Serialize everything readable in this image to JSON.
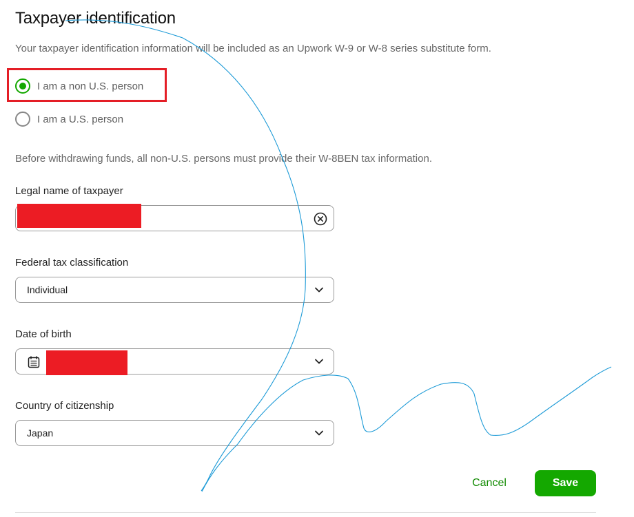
{
  "page": {
    "title": "Taxpayer identification",
    "subtitle": "Your taxpayer identification information will be included as an Upwork W-9 or W-8 series substitute form."
  },
  "person_type": {
    "options": [
      {
        "label": "I am a non U.S. person",
        "selected": true
      },
      {
        "label": "I am a U.S. person",
        "selected": false
      }
    ]
  },
  "info_text": "Before withdrawing funds, all non-U.S. persons must provide their W-8BEN tax information.",
  "form": {
    "legal_name": {
      "label": "Legal name of taxpayer",
      "value": "",
      "redacted": true,
      "clear_icon": "close-circle-icon"
    },
    "tax_classification": {
      "label": "Federal tax classification",
      "value": "Individual"
    },
    "date_of_birth": {
      "label": "Date of birth",
      "value": "",
      "redacted": true,
      "icon": "calendar-icon"
    },
    "citizenship": {
      "label": "Country of citizenship",
      "value": "Japan"
    }
  },
  "actions": {
    "cancel_label": "Cancel",
    "save_label": "Save"
  },
  "colors": {
    "accent": "#14a800",
    "link": "#108a00",
    "highlight": "#e41e26",
    "redaction": "#ec1c24",
    "scribble": "#1e9bd7"
  }
}
